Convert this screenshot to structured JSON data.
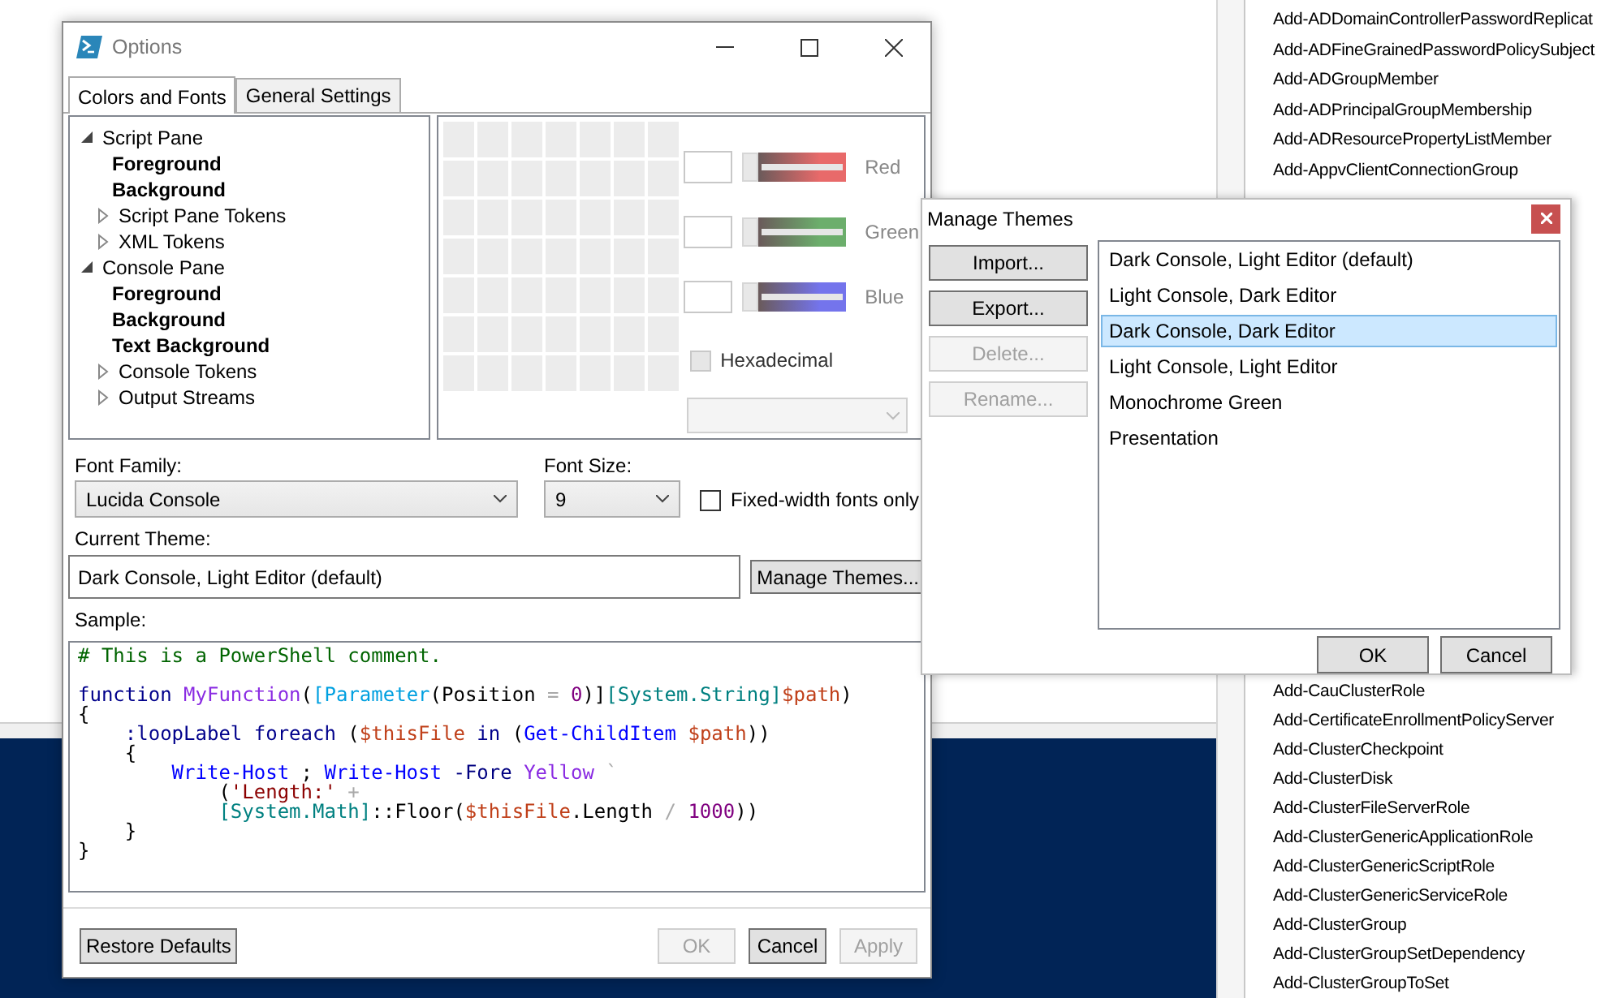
{
  "options_window": {
    "title": "Options",
    "tabs": [
      {
        "label": "Colors and Fonts",
        "selected": true
      },
      {
        "label": "General Settings",
        "selected": false
      }
    ],
    "tree": [
      {
        "label": "Script Pane",
        "expanded": true,
        "children": [
          {
            "label": "Foreground"
          },
          {
            "label": "Background"
          },
          {
            "label": "Script Pane Tokens",
            "expanded": false
          },
          {
            "label": "XML Tokens",
            "expanded": false
          }
        ]
      },
      {
        "label": "Console Pane",
        "expanded": true,
        "children": [
          {
            "label": "Foreground"
          },
          {
            "label": "Background"
          },
          {
            "label": "Text Background"
          },
          {
            "label": "Console Tokens",
            "expanded": false
          },
          {
            "label": "Output Streams",
            "expanded": false
          }
        ]
      }
    ],
    "color_channels": [
      {
        "label": "Red",
        "color": "#e86a6a",
        "level": 0
      },
      {
        "label": "Green",
        "color": "#6cae6c",
        "level": 0
      },
      {
        "label": "Blue",
        "color": "#7474ec",
        "level": 0
      }
    ],
    "hexadecimal": {
      "label": "Hexadecimal",
      "checked": false,
      "disabled": true
    },
    "color_dropdown": {
      "disabled": true
    },
    "font_family": {
      "label": "Font Family:",
      "value": "Lucida Console"
    },
    "font_size": {
      "label": "Font Size:",
      "value": "9"
    },
    "fixed_width": {
      "label": "Fixed-width fonts only",
      "checked": false
    },
    "current_theme": {
      "label": "Current Theme:",
      "value": "Dark Console, Light Editor (default)"
    },
    "manage_button": "Manage Themes...",
    "sample": {
      "label": "Sample:",
      "lines": [
        {
          "kind": "code",
          "tokens": [
            {
              "text": "# This is a PowerShell comment.",
              "kind": "comment"
            }
          ]
        },
        {
          "kind": "blank"
        },
        {
          "kind": "code",
          "tokens": [
            {
              "text": "function ",
              "kind": "keyword"
            },
            {
              "text": "MyFunction",
              "kind": "argument"
            },
            {
              "text": "(",
              "kind": "plain"
            },
            {
              "text": "[Parameter",
              "kind": "attribute"
            },
            {
              "text": "(Position ",
              "kind": "plain"
            },
            {
              "text": "= ",
              "kind": "operator"
            },
            {
              "text": "0",
              "kind": "number"
            },
            {
              "text": ")]",
              "kind": "plain"
            },
            {
              "text": "[System.String]",
              "kind": "type"
            },
            {
              "text": "$path",
              "kind": "variable"
            },
            {
              "text": ")",
              "kind": "plain"
            }
          ]
        },
        {
          "kind": "code",
          "tokens": [
            {
              "text": "{",
              "kind": "plain"
            }
          ]
        },
        {
          "kind": "code",
          "tokens": [
            {
              "text": "    :loopLabel foreach ",
              "kind": "keyword"
            },
            {
              "text": "(",
              "kind": "plain"
            },
            {
              "text": "$thisFile",
              "kind": "variable"
            },
            {
              "text": " in ",
              "kind": "keyword"
            },
            {
              "text": "(",
              "kind": "plain"
            },
            {
              "text": "Get-ChildItem ",
              "kind": "command"
            },
            {
              "text": "$path",
              "kind": "variable"
            },
            {
              "text": "))",
              "kind": "plain"
            }
          ]
        },
        {
          "kind": "code",
          "tokens": [
            {
              "text": "    {",
              "kind": "plain"
            }
          ]
        },
        {
          "kind": "code",
          "tokens": [
            {
              "text": "        Write-Host",
              "kind": "command"
            },
            {
              "text": " ; ",
              "kind": "plain"
            },
            {
              "text": "Write-Host ",
              "kind": "command"
            },
            {
              "text": "-Fore ",
              "kind": "parameter"
            },
            {
              "text": "Yellow ",
              "kind": "argument"
            },
            {
              "text": "`",
              "kind": "operator"
            }
          ]
        },
        {
          "kind": "code",
          "tokens": [
            {
              "text": "            (",
              "kind": "plain"
            },
            {
              "text": "'Length:'",
              "kind": "string"
            },
            {
              "text": " +",
              "kind": "operator"
            }
          ]
        },
        {
          "kind": "code",
          "tokens": [
            {
              "text": "            [System.Math]",
              "kind": "type"
            },
            {
              "text": "::Floor(",
              "kind": "plain"
            },
            {
              "text": "$thisFile",
              "kind": "variable"
            },
            {
              "text": ".Length ",
              "kind": "plain"
            },
            {
              "text": "/ ",
              "kind": "operator"
            },
            {
              "text": "1000",
              "kind": "number"
            },
            {
              "text": "))",
              "kind": "plain"
            }
          ]
        },
        {
          "kind": "code",
          "tokens": [
            {
              "text": "    }",
              "kind": "plain"
            }
          ]
        },
        {
          "kind": "code",
          "tokens": [
            {
              "text": "}",
              "kind": "plain"
            }
          ]
        }
      ]
    },
    "buttons": [
      {
        "label": "Restore Defaults",
        "disabled": false
      },
      {
        "label": "OK",
        "disabled": true
      },
      {
        "label": "Cancel",
        "disabled": false
      },
      {
        "label": "Apply",
        "disabled": true
      }
    ]
  },
  "manage_themes": {
    "title": "Manage Themes",
    "side_buttons": [
      {
        "label": "Import...",
        "disabled": false
      },
      {
        "label": "Export...",
        "disabled": false
      },
      {
        "label": "Delete...",
        "disabled": true
      },
      {
        "label": "Rename...",
        "disabled": true
      }
    ],
    "themes": [
      {
        "label": "Dark Console, Light Editor (default)",
        "selected": false
      },
      {
        "label": "Light Console, Dark Editor",
        "selected": false
      },
      {
        "label": "Dark Console, Dark Editor",
        "selected": true
      },
      {
        "label": "Light Console, Light Editor",
        "selected": false
      },
      {
        "label": "Monochrome Green",
        "selected": false
      },
      {
        "label": "Presentation",
        "selected": false
      }
    ],
    "buttons": [
      "OK",
      "Cancel"
    ]
  },
  "command_list": {
    "items_top": [
      "Add-ADDomainControllerPasswordReplicat",
      "Add-ADFineGrainedPasswordPolicySubject",
      "Add-ADGroupMember",
      "Add-ADPrincipalGroupMembership",
      "Add-ADResourcePropertyListMember",
      "Add-AppvClientConnectionGroup"
    ],
    "items_bottom": [
      "Add-CauClusterRole",
      "Add-CertificateEnrollmentPolicyServer",
      "Add-ClusterCheckpoint",
      "Add-ClusterDisk",
      "Add-ClusterFileServerRole",
      "Add-ClusterGenericApplicationRole",
      "Add-ClusterGenericScriptRole",
      "Add-ClusterGenericServiceRole",
      "Add-ClusterGroup",
      "Add-ClusterGroupSetDependency",
      "Add-ClusterGroupToSet"
    ]
  }
}
